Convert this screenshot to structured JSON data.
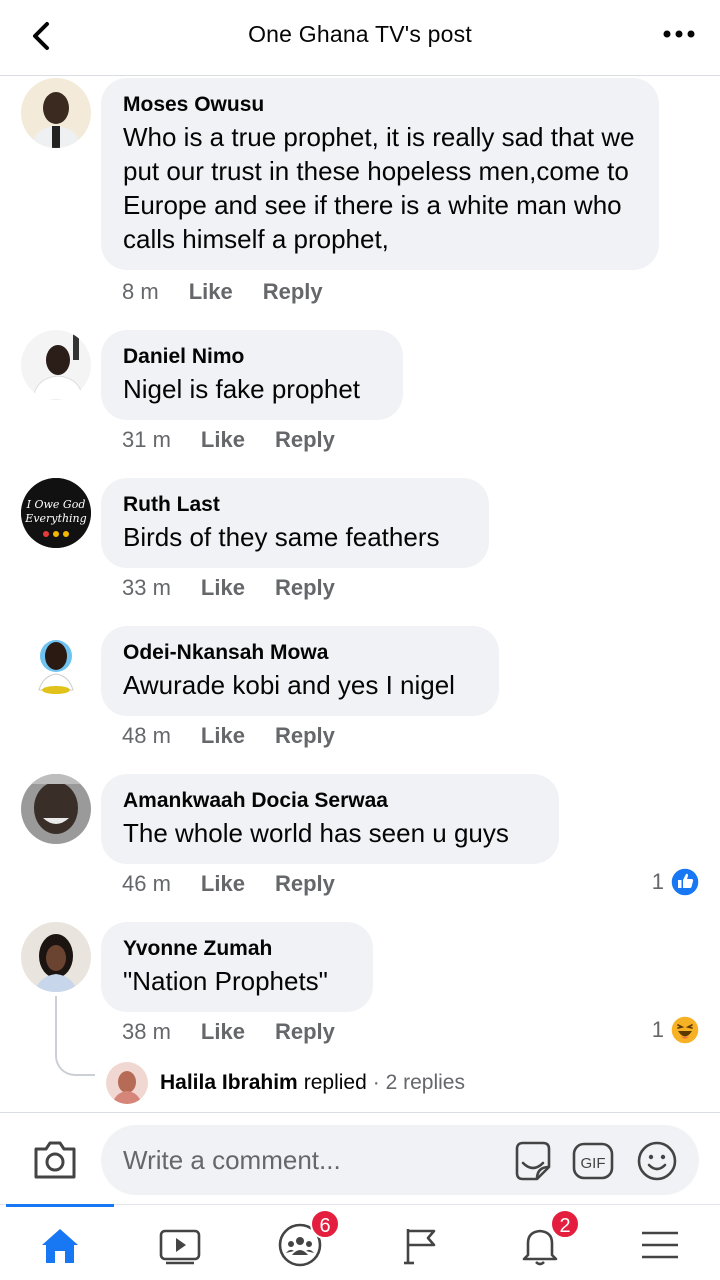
{
  "header": {
    "title": "One Ghana TV's post"
  },
  "comments": [
    {
      "author": "Moses Owusu",
      "text": "Who is a true prophet, it is really sad that we put our trust in these hopeless men,come to Europe and see if there is a white man who calls himself a prophet,",
      "time": "8 m",
      "like": "Like",
      "reply": "Reply"
    },
    {
      "author": "Daniel Nimo",
      "text": "Nigel is fake prophet",
      "time": "31 m",
      "like": "Like",
      "reply": "Reply"
    },
    {
      "author": "Ruth Last",
      "text": "Birds of they same feathers",
      "time": "33 m",
      "like": "Like",
      "reply": "Reply",
      "avatar_text": [
        "I Owe God",
        "Everything"
      ]
    },
    {
      "author": "Odei-Nkansah Mowa",
      "text": "Awurade kobi and yes I nigel",
      "time": "48 m",
      "like": "Like",
      "reply": "Reply"
    },
    {
      "author": "Amankwaah Docia Serwaa",
      "text": "The whole world has seen u guys",
      "time": "46 m",
      "like": "Like",
      "reply": "Reply",
      "reaction_count": "1",
      "reaction_icon": "like-icon"
    },
    {
      "author": "Yvonne Zumah",
      "text": "\"Nation Prophets\"",
      "time": "38 m",
      "like": "Like",
      "reply": "Reply",
      "reaction_count": "1",
      "reaction_icon": "haha-icon"
    }
  ],
  "reply_preview": {
    "name": "Halila Ibrahim",
    "verb": "replied",
    "count": "· 2 replies"
  },
  "composer": {
    "placeholder": "Write a comment...",
    "gif_label": "GIF"
  },
  "nav": {
    "groups_badge": "6",
    "notifications_badge": "2"
  },
  "colors": {
    "accent": "#1877f2",
    "badge": "#e41e3f",
    "bubble": "#f0f2f5",
    "muted": "#65676b"
  }
}
